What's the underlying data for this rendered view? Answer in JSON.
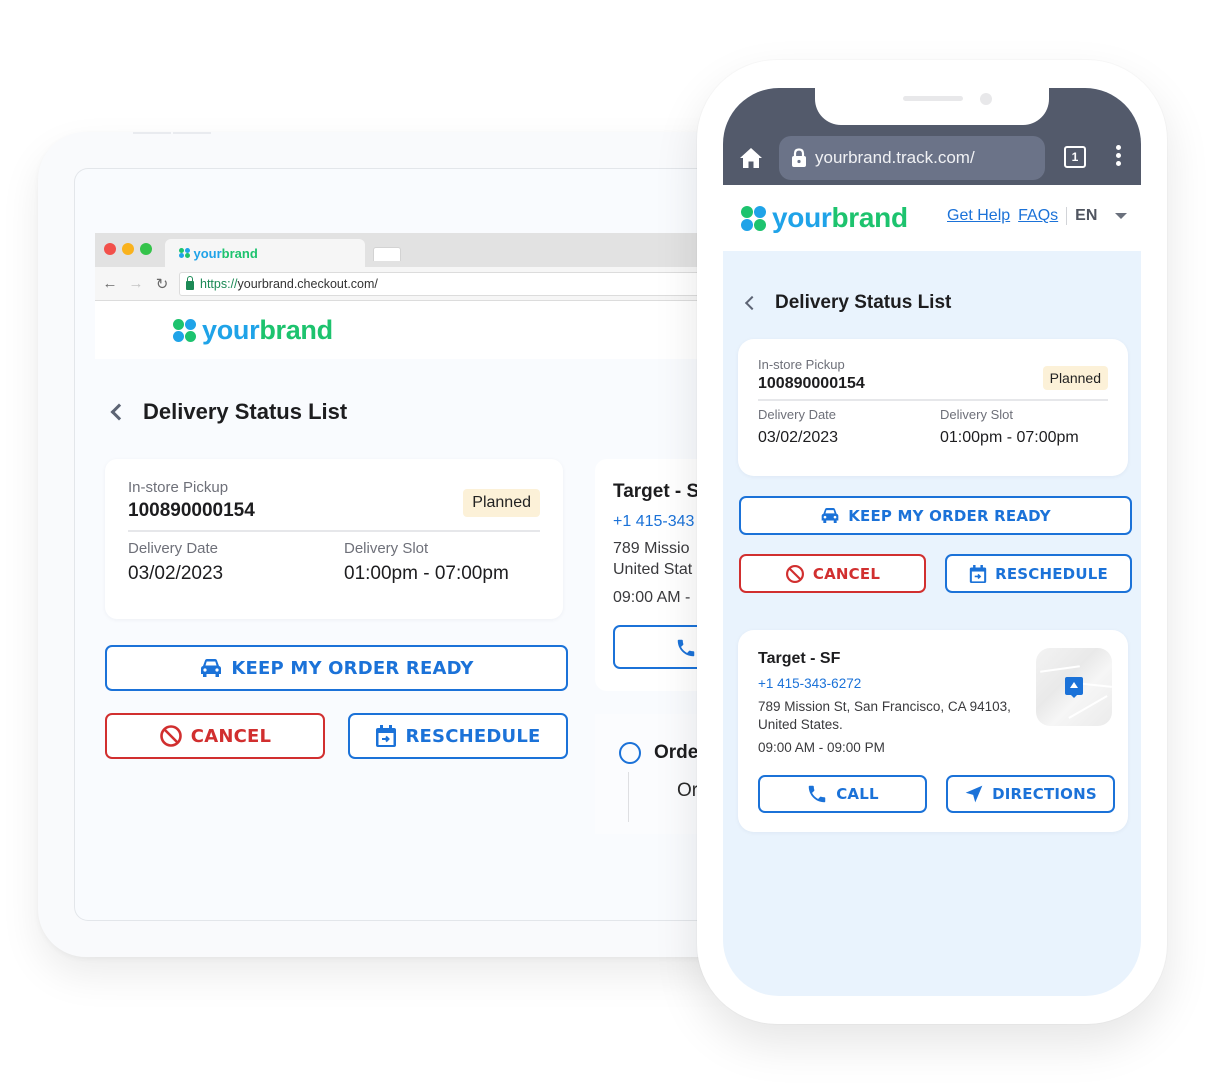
{
  "brand": {
    "prefix": "your",
    "suffix": "brand",
    "primary_color": "#1b72d8",
    "danger_color": "#d12f2f",
    "logo_blue": "#1fa3e8",
    "logo_green": "#1dc36e"
  },
  "desktop": {
    "browser": {
      "tab_title_prefix": "your",
      "tab_title_suffix": "brand",
      "url_scheme": "https://",
      "url_host": "yourbrand.checkout.com/",
      "back_icon": "←",
      "forward_icon": "→",
      "reload_icon": "↻"
    },
    "page_title": "Delivery Status List",
    "order": {
      "type_label": "In-store Pickup",
      "order_id": "100890000154",
      "status": "Planned",
      "date_label": "Delivery Date",
      "date_value": "03/02/2023",
      "slot_label": "Delivery Slot",
      "slot_value": "01:00pm - 07:00pm"
    },
    "buttons": {
      "keep_ready": "KEEP MY ORDER READY",
      "cancel": "CANCEL",
      "reschedule": "RESCHEDULE"
    },
    "store_peek": {
      "name": "Target - S",
      "phone": "+1 415-343",
      "address_line1": "789 Missio",
      "address_line2": "United Stat",
      "hours": "09:00 AM -"
    },
    "timeline_peek": {
      "title": "Orde",
      "subtitle": "Or"
    }
  },
  "mobile": {
    "url": "yourbrand.track.com/",
    "tab_count": "1",
    "nav": {
      "get_help": "Get Help",
      "faqs": "FAQs",
      "language": "EN"
    },
    "page_title": "Delivery Status List",
    "order": {
      "type_label": "In-store Pickup",
      "order_id": "100890000154",
      "status": "Planned",
      "date_label": "Delivery Date",
      "date_value": "03/02/2023",
      "slot_label": "Delivery Slot",
      "slot_value": "01:00pm - 07:00pm"
    },
    "buttons": {
      "keep_ready": "KEEP MY ORDER READY",
      "cancel": "CANCEL",
      "reschedule": "RESCHEDULE",
      "call": "CALL",
      "directions": "DIRECTIONS"
    },
    "store": {
      "name": "Target - SF",
      "phone": "+1 415-343-6272",
      "address_line1": "789 Mission St, San Francisco, CA 94103,",
      "address_line2": "United States.",
      "hours": "09:00 AM - 09:00 PM"
    }
  }
}
